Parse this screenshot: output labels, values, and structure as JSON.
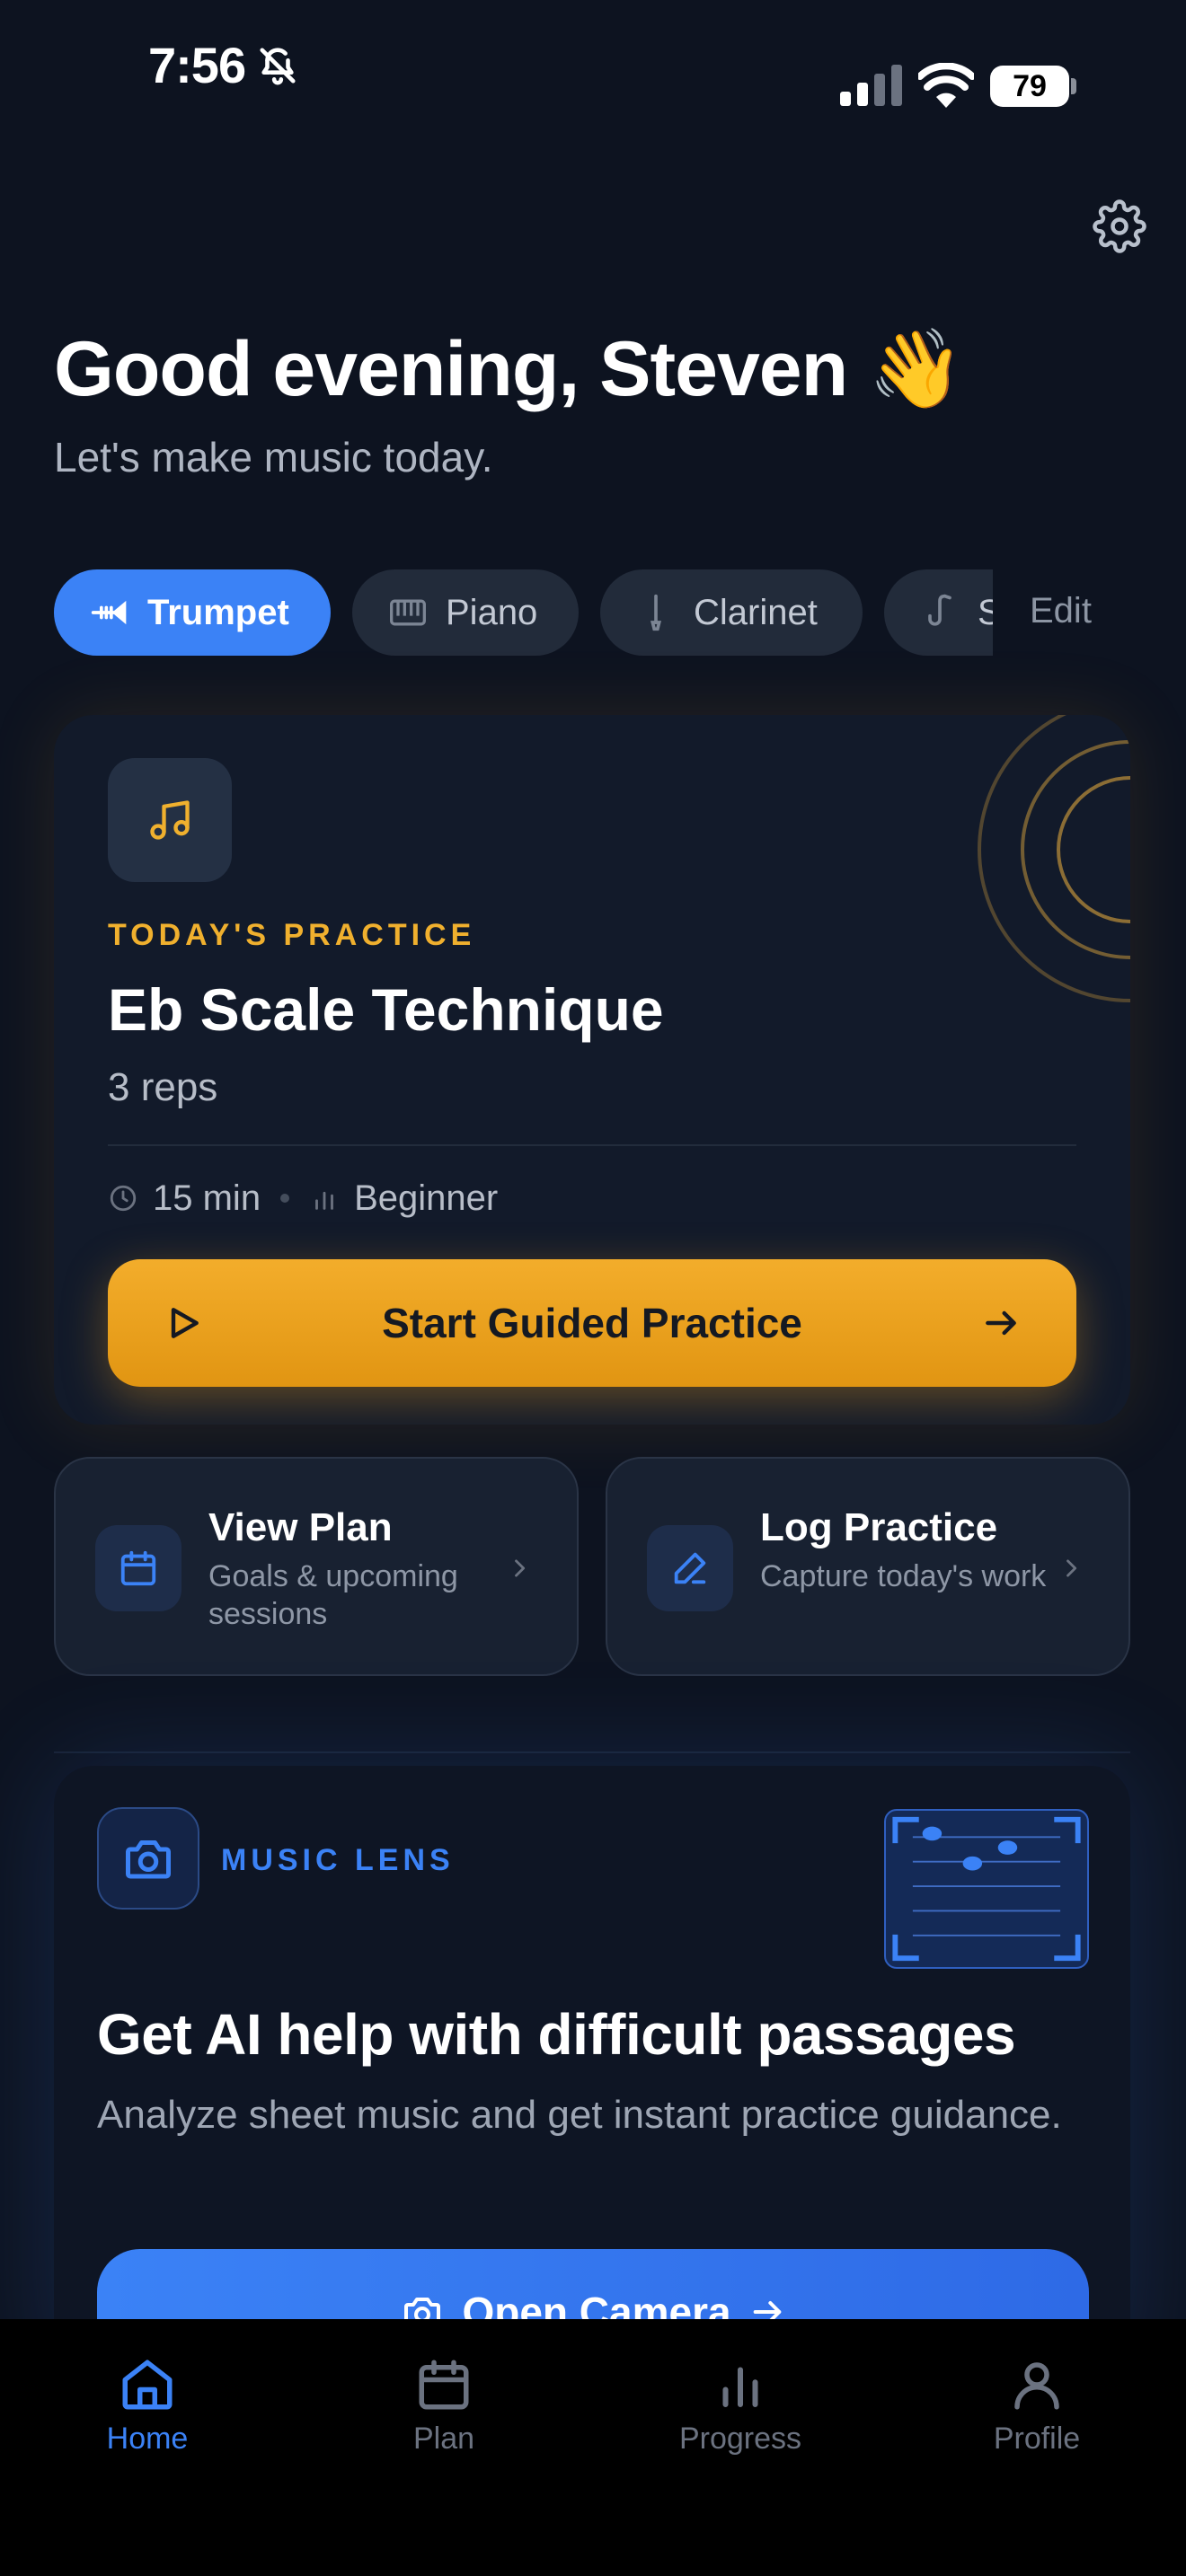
{
  "status_bar": {
    "time": "7:56",
    "battery": "79"
  },
  "header": {
    "greeting": "Good evening, Steven 👋",
    "subtitle": "Let's make music today."
  },
  "instruments": {
    "items": [
      {
        "label": "Trumpet",
        "icon": "trumpet-icon",
        "active": true
      },
      {
        "label": "Piano",
        "icon": "piano-icon",
        "active": false
      },
      {
        "label": "Clarinet",
        "icon": "clarinet-icon",
        "active": false
      },
      {
        "label": "Saxophone",
        "icon": "saxophone-icon",
        "active": false
      }
    ],
    "edit_label": "Edit"
  },
  "practice": {
    "kicker": "TODAY'S PRACTICE",
    "title": "Eb Scale Technique",
    "reps": "3 reps",
    "duration": "15 min",
    "level": "Beginner",
    "start_label": "Start Guided Practice"
  },
  "quick_actions": [
    {
      "title": "View Plan",
      "subtitle": "Goals & upcoming sessions",
      "icon": "calendar-icon"
    },
    {
      "title": "Log Practice",
      "subtitle": "Capture today's work",
      "icon": "pencil-icon"
    }
  ],
  "music_lens": {
    "kicker": "MUSIC LENS",
    "title": "Get AI help with difficult passages",
    "description": "Analyze sheet music and get instant practice guidance.",
    "button_label": "Open Camera"
  },
  "tabbar": {
    "items": [
      {
        "label": "Home",
        "icon": "home-icon",
        "active": true
      },
      {
        "label": "Plan",
        "icon": "calendar-icon",
        "active": false
      },
      {
        "label": "Progress",
        "icon": "bar-chart-icon",
        "active": false
      },
      {
        "label": "Profile",
        "icon": "person-icon",
        "active": false
      }
    ]
  },
  "colors": {
    "background": "#0d1320",
    "accent_blue": "#3b82f6",
    "accent_amber": "#f0b02e"
  }
}
